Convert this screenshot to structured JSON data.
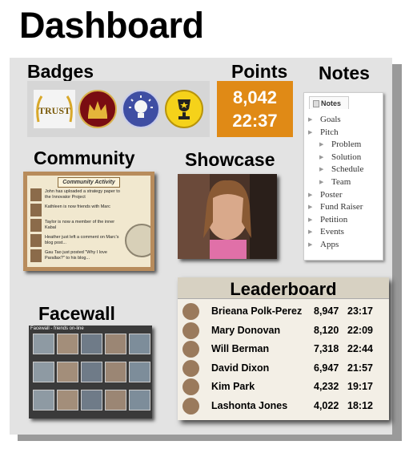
{
  "title": "Dashboard",
  "sections": {
    "badges": "Badges",
    "points": "Points",
    "notes": "Notes",
    "community": "Community",
    "showcase": "Showcase",
    "facewall": "Facewall"
  },
  "badges": [
    {
      "name": "trust-badge",
      "label": "TRUST"
    },
    {
      "name": "crown-badge"
    },
    {
      "name": "lightbulb-badge"
    },
    {
      "name": "trophy-badge"
    }
  ],
  "points": {
    "score": "8,042",
    "time": "22:37"
  },
  "notes": {
    "tab": "Notes",
    "items": [
      {
        "label": "Goals",
        "level": 0
      },
      {
        "label": "Pitch",
        "level": 0
      },
      {
        "label": "Problem",
        "level": 1
      },
      {
        "label": "Solution",
        "level": 1
      },
      {
        "label": "Schedule",
        "level": 1
      },
      {
        "label": "Team",
        "level": 1
      },
      {
        "label": "Poster",
        "level": 0
      },
      {
        "label": "Fund Raiser",
        "level": 0
      },
      {
        "label": "Petition",
        "level": 0
      },
      {
        "label": "Events",
        "level": 0
      },
      {
        "label": "Apps",
        "level": 0
      }
    ]
  },
  "community": {
    "header": "Community Activity",
    "entries": [
      "John has uploaded a strategy paper to the Innovator Project",
      "Kathleen is now friends with Marc",
      "Taylor is now a member of the inner Kabal",
      "Heather just left a comment on Marc's blog post...",
      "Gau Tao just posted \"Why I love Parallax?\" to his blog..."
    ]
  },
  "facewall": {
    "header": "Facewall - friends on-line"
  },
  "leaderboard": {
    "title": "Leaderboard",
    "rows": [
      {
        "name": "Brieana Polk-Perez",
        "points": "8,947",
        "time": "23:17"
      },
      {
        "name": "Mary Donovan",
        "points": "8,120",
        "time": "22:09"
      },
      {
        "name": "Will Berman",
        "points": "7,318",
        "time": "22:44"
      },
      {
        "name": "David Dixon",
        "points": "6,947",
        "time": "21:57"
      },
      {
        "name": "Kim Park",
        "points": "4,232",
        "time": "19:17"
      },
      {
        "name": "Lashonta Jones",
        "points": "4,022",
        "time": "18:12"
      }
    ]
  },
  "colors": {
    "points_bg": "#e08a16",
    "panel_bg": "#e3e3e3",
    "panel_shadow": "#9a9a9a"
  }
}
